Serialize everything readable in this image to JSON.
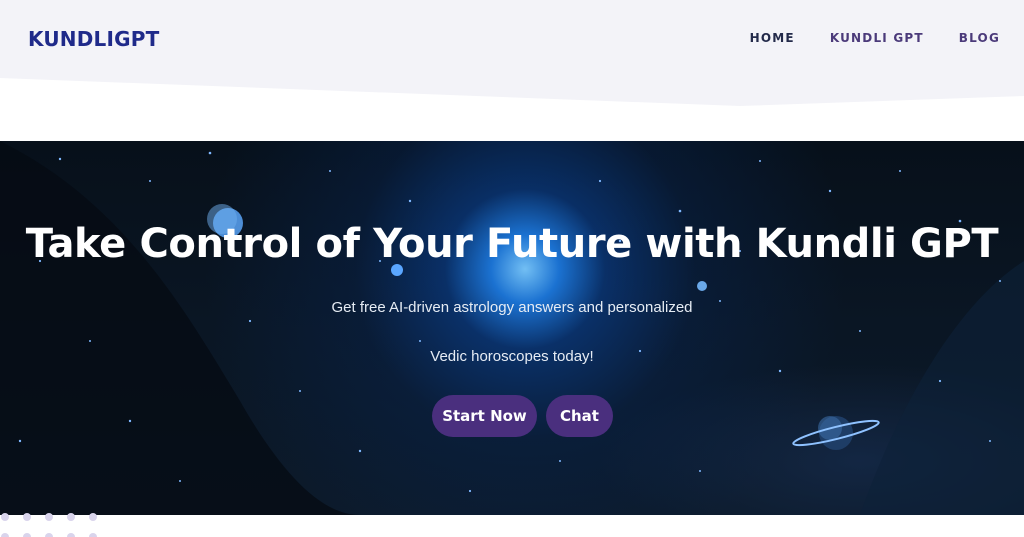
{
  "header": {
    "logo": "KUNDLIGPT",
    "nav": [
      {
        "label": "HOME",
        "active": true
      },
      {
        "label": "KUNDLI GPT",
        "active": false
      },
      {
        "label": "BLOG",
        "active": false
      }
    ]
  },
  "hero": {
    "title": "Take Control of Your Future with Kundli GPT",
    "subtitle_line1": "Get free AI-driven astrology answers and personalized",
    "subtitle_line2": "Vedic horoscopes today!",
    "buttons": {
      "start": "Start Now",
      "chat": "Chat"
    }
  },
  "colors": {
    "logo": "#1f2a8a",
    "button": "#4a2f7e",
    "header_bg": "#f3f3f8",
    "space_glow": "#1e82f0"
  },
  "icons": [
    "planet-icon",
    "ringed-planet-icon",
    "decorative-dots"
  ]
}
